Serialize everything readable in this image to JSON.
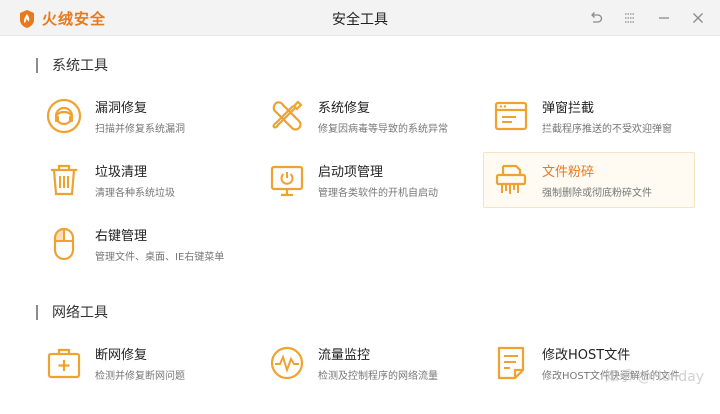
{
  "app": {
    "brand": "火绒安全",
    "window_title": "安全工具"
  },
  "colors": {
    "accent": "#f0a22e",
    "brand": "#e8791c"
  },
  "window_controls": [
    {
      "name": "back-icon"
    },
    {
      "name": "menu-icon"
    },
    {
      "name": "minimize-icon"
    },
    {
      "name": "close-icon"
    }
  ],
  "sections": {
    "system": {
      "title": "系统工具"
    },
    "network": {
      "title": "网络工具"
    }
  },
  "tools": {
    "vuln_repair": {
      "icon": "lifebuoy-icon",
      "name": "漏洞修复",
      "desc": "扫描并修复系统漏洞"
    },
    "sys_repair": {
      "icon": "tools-icon",
      "name": "系统修复",
      "desc": "修复因病毒等导致的系统异常"
    },
    "popup_block": {
      "icon": "window-icon",
      "name": "弹窗拦截",
      "desc": "拦截程序推送的不受欢迎弹窗"
    },
    "junk_clean": {
      "icon": "trash-icon",
      "name": "垃圾清理",
      "desc": "清理各种系统垃圾"
    },
    "startup_mgr": {
      "icon": "monitor-icon",
      "name": "启动项管理",
      "desc": "管理各类软件的开机自启动"
    },
    "file_shred": {
      "icon": "shredder-icon",
      "name": "文件粉碎",
      "desc": "强制删除或彻底粉碎文件"
    },
    "rclick_mgr": {
      "icon": "mouse-icon",
      "name": "右键管理",
      "desc": "管理文件、桌面、IE右键菜单"
    },
    "net_repair": {
      "icon": "first-aid-icon",
      "name": "断网修复",
      "desc": "检测并修复断网问题"
    },
    "traffic_mon": {
      "icon": "gauge-icon",
      "name": "流量监控",
      "desc": "检测及控制程序的网络流量"
    },
    "host_edit": {
      "icon": "document-icon",
      "name": "修改HOST文件",
      "desc": "修改HOST文件快速解析的文件"
    }
  },
  "watermark": "知乎 @Holiday"
}
